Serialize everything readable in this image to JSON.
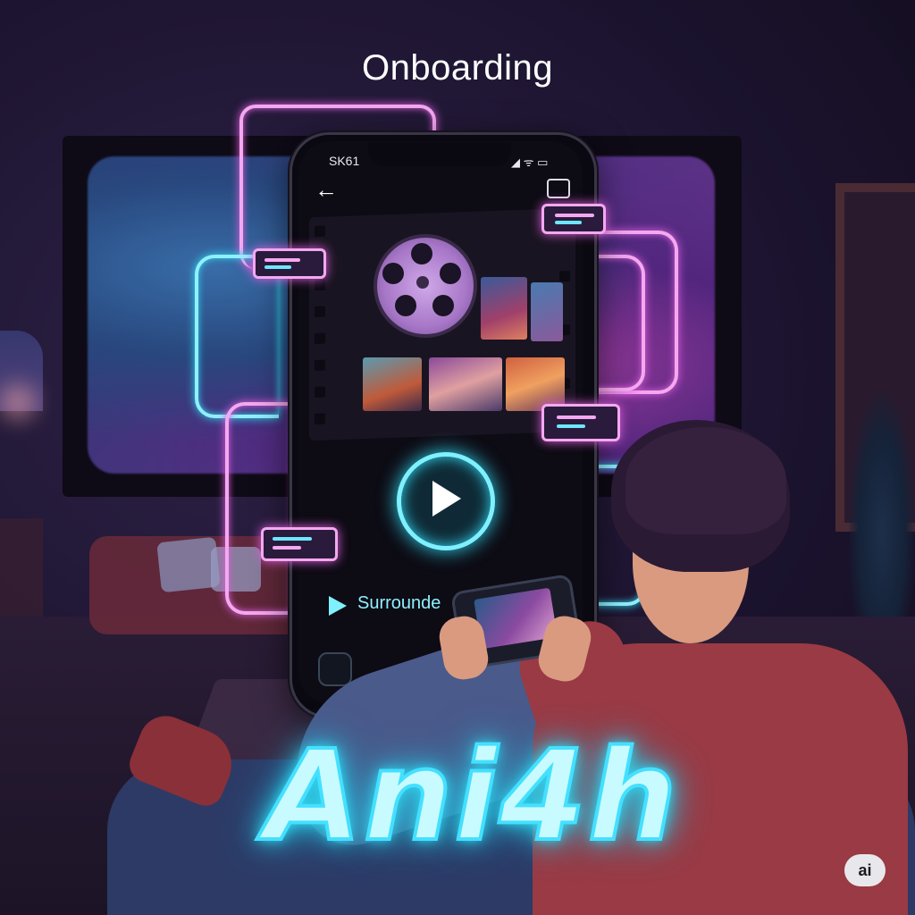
{
  "header": {
    "title": "Onboarding"
  },
  "phone": {
    "status_left": "SK61",
    "status_right": "◢ ᯤ ▭",
    "surround_label": "Surrounde"
  },
  "brand": {
    "name": "Ani4h"
  },
  "badge": {
    "label": "ai"
  },
  "colors": {
    "neon_cyan": "#8ff0ff",
    "neon_pink": "#f4a8f0",
    "background": "#1b1328"
  },
  "icons": [
    "back-arrow-icon",
    "cast-icon",
    "film-reel-icon",
    "play-icon",
    "play-triangle-icon"
  ]
}
